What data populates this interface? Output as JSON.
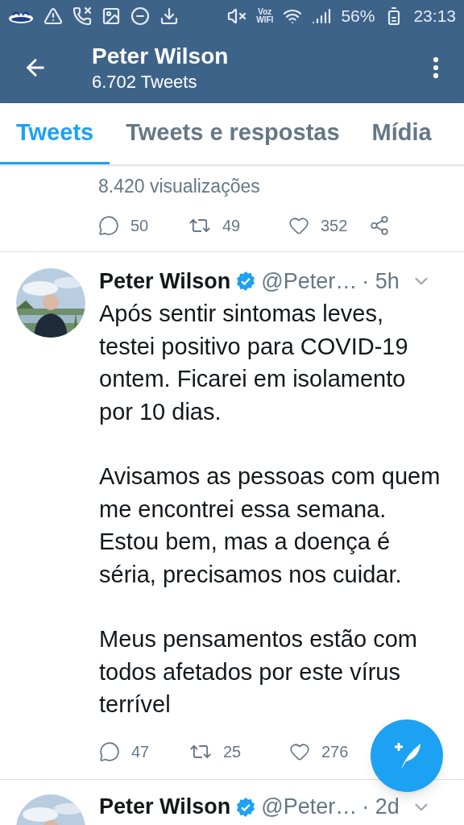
{
  "status_bar": {
    "wifi_call": [
      "Voz",
      "WIFI"
    ],
    "battery": "56%",
    "time": "23:13"
  },
  "header": {
    "name": "Peter Wilson",
    "count": "6.702 Tweets"
  },
  "tabs": [
    {
      "label": "Tweets",
      "selected": true
    },
    {
      "label": "Tweets e respostas",
      "selected": false
    },
    {
      "label": "Mídia",
      "selected": false
    }
  ],
  "previous_tweet": {
    "views": "8.420 visualizações",
    "replies": "50",
    "retweets": "49",
    "likes": "352"
  },
  "tweets": [
    {
      "name": "Peter Wilson",
      "verified": true,
      "handle": "@Peter…",
      "time": "· 5h",
      "paragraphs": [
        "Após sentir sintomas leves, testei positivo para COVID-19 ontem. Ficarei em isolamento por 10 dias.",
        "Avisamos as pessoas com quem me encontrei essa semana. Estou bem, mas a doença é séria, precisamos nos cuidar.",
        "Meus pensamentos estão com todos afetados por este vírus terrível"
      ],
      "replies": "47",
      "retweets": "25",
      "likes": "276"
    },
    {
      "name": "Peter Wilson",
      "verified": true,
      "handle": "@Peter…",
      "time": "· 2d"
    }
  ]
}
